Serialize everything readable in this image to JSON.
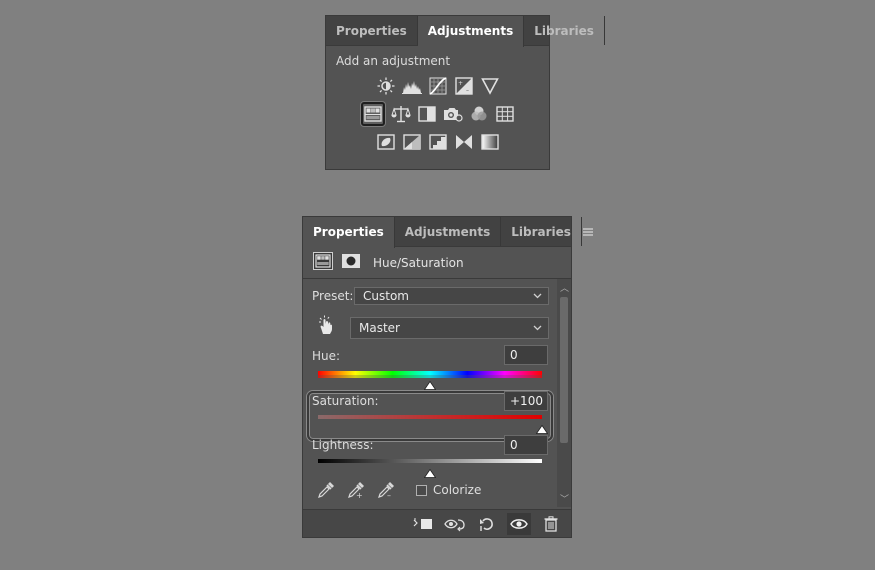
{
  "panel1": {
    "tabs": [
      "Properties",
      "Adjustments",
      "Libraries"
    ],
    "active_tab": "Adjustments",
    "heading": "Add an adjustment",
    "rows": [
      [
        "brightness-contrast-icon",
        "levels-icon",
        "curves-icon",
        "exposure-icon",
        "vibrance-icon"
      ],
      [
        "hue-saturation-icon",
        "color-balance-icon",
        "black-white-icon",
        "photo-filter-icon",
        "channel-mixer-icon",
        "color-lookup-icon"
      ],
      [
        "invert-icon",
        "posterize-icon",
        "threshold-icon",
        "selective-color-icon",
        "gradient-map-icon"
      ]
    ],
    "selected": "hue-saturation-icon"
  },
  "panel2": {
    "tabs": [
      "Properties",
      "Adjustments",
      "Libraries"
    ],
    "active_tab": "Properties",
    "title": "Hue/Saturation",
    "preset_label": "Preset:",
    "preset_value": "Custom",
    "channel_value": "Master",
    "hue_label": "Hue:",
    "hue_value": "0",
    "hue_position": 0.5,
    "saturation_label": "Saturation:",
    "saturation_value": "+100",
    "saturation_position": 1.0,
    "lightness_label": "Lightness:",
    "lightness_value": "0",
    "lightness_position": 0.5,
    "colorize_label": "Colorize",
    "colorize_checked": false
  },
  "colors": {
    "panel_bg": "#535353",
    "tabbar_bg": "#424242",
    "page_bg": "#808080",
    "saturation_track_end": "#e00000"
  }
}
